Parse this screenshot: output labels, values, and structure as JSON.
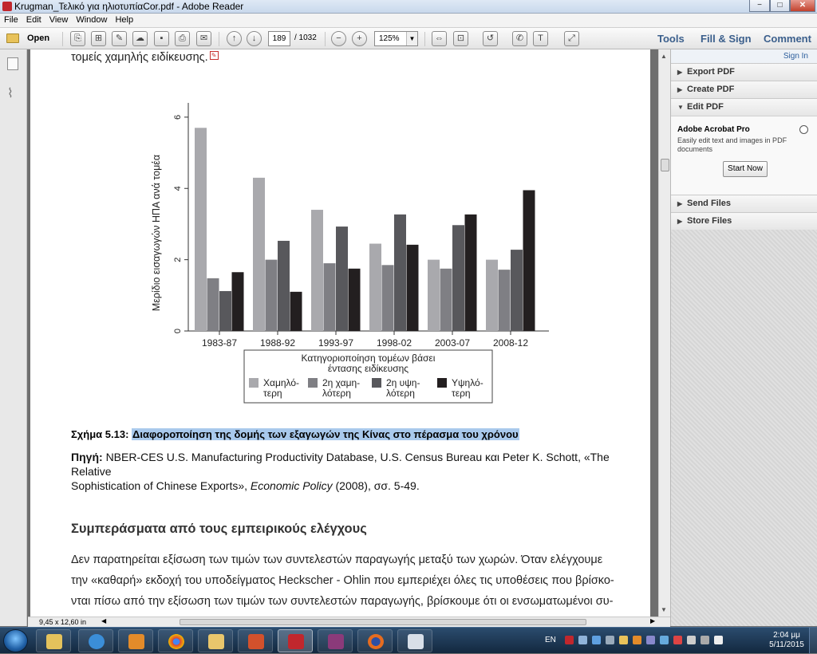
{
  "window": {
    "title": "Krugman_Τελικό για ηλιοτυπίαCor.pdf - Adobe Reader",
    "btn_min": "−",
    "btn_max": "□",
    "btn_close": "✕"
  },
  "menu": [
    "File",
    "Edit",
    "View",
    "Window",
    "Help"
  ],
  "toolbar": {
    "open_label": "Open",
    "page_current": "189",
    "page_total": "/ 1032",
    "zoom": "125%",
    "tabs": [
      "Tools",
      "Fill & Sign",
      "Comment"
    ]
  },
  "right_panel": {
    "sign_in": "Sign In",
    "sections": [
      "Export PDF",
      "Create PDF",
      "Edit PDF",
      "Send Files",
      "Store Files"
    ],
    "edit_pdf": {
      "product": "Adobe Acrobat Pro",
      "description": "Easily edit text and images in PDF documents",
      "button": "Start Now"
    }
  },
  "page": {
    "prev_text": "τομείς χαμηλής ειδίκευσης.",
    "figure_caption_prefix": "Σχήμα 5.13:",
    "figure_caption_title": "Διαφοροποίηση της δομής των εξαγωγών της Κίνας στο πέρασμα του χρόνου",
    "source_label": "Πηγή:",
    "source_text_1": "NBER-CES U.S. Manufacturing Productivity Database, U.S. Census Bureau και Peter K. Schott, «The Relative",
    "source_text_2": "Sophistication of Chinese Exports»,",
    "source_journal": "Economic Policy",
    "source_text_3": "(2008), σσ. 5-49.",
    "section_heading": "Συμπεράσματα από τους εμπειρικούς ελέγχους",
    "body_lines": [
      "Δεν παρατηρείται εξίσωση των τιμών των συντελεστών παραγωγής μεταξύ των χωρών. Όταν ελέγχουμε",
      "την «καθαρή» εκδοχή του υποδείγματος Heckscher - Ohlin που εμπεριέχει όλες τις υποθέσεις που βρίσκο-",
      "νται πίσω από την εξίσωση των τιμών των συντελεστών παραγωγής, βρίσκουμε ότι οι ενσωματωμένοι συ-"
    ]
  },
  "chart_data": {
    "type": "bar",
    "categories": [
      "1983-87",
      "1988-92",
      "1993-97",
      "1998-02",
      "2003-07",
      "2008-12"
    ],
    "series": [
      {
        "name": "Χαμηλό-τερη",
        "color": "#a9a9ad",
        "values": [
          5.7,
          4.3,
          3.4,
          2.45,
          2.0,
          2.0
        ]
      },
      {
        "name": "2η χαμη-λότερη",
        "color": "#7f7f84",
        "values": [
          1.48,
          2.0,
          1.9,
          1.85,
          1.75,
          1.72
        ]
      },
      {
        "name": "2η υψη-λότερη",
        "color": "#58585c",
        "values": [
          1.12,
          2.53,
          2.93,
          3.27,
          2.97,
          2.28
        ]
      },
      {
        "name": "Υψηλό-τερη",
        "color": "#231f20",
        "values": [
          1.65,
          1.1,
          1.75,
          2.42,
          3.27,
          3.95
        ]
      }
    ],
    "ylabel": "Μερίδιο εισαγωγών ΗΠΑ ανά τομέα",
    "yticks": [
      "0",
      "2",
      "4",
      "6"
    ],
    "ylim": [
      0,
      6.4
    ],
    "legend_title_1": "Κατηγοριοποίηση τομέων βάσει",
    "legend_title_2": "έντασης ειδίκευσης",
    "legend_labels": [
      [
        "Χαμηλό-",
        "τερη"
      ],
      [
        "2η χαμη-",
        "λότερη"
      ],
      [
        "2η υψη-",
        "λότερη"
      ],
      [
        "Υψηλό-",
        "τερη"
      ]
    ]
  },
  "status": {
    "page_size": "9,45 x 12,60 in"
  },
  "taskbar": {
    "lang": "EN",
    "time": "2:04 μμ",
    "date": "5/11/2015"
  }
}
